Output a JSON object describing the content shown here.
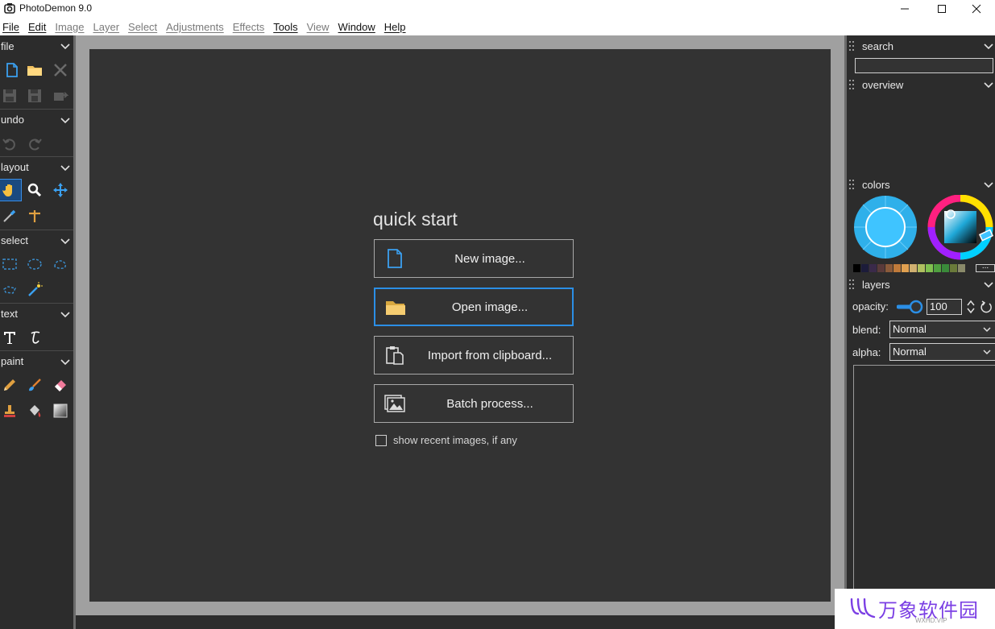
{
  "window": {
    "title": "PhotoDemon 9.0",
    "minimize_icon": "minimize-icon",
    "maximize_icon": "maximize-icon",
    "close_icon": "close-icon"
  },
  "menu": [
    {
      "label": "File",
      "enabled": true
    },
    {
      "label": "Edit",
      "enabled": true
    },
    {
      "label": "Image",
      "enabled": false
    },
    {
      "label": "Layer",
      "enabled": false
    },
    {
      "label": "Select",
      "enabled": false
    },
    {
      "label": "Adjustments",
      "enabled": false
    },
    {
      "label": "Effects",
      "enabled": false
    },
    {
      "label": "Tools",
      "enabled": true
    },
    {
      "label": "View",
      "enabled": false
    },
    {
      "label": "Window",
      "enabled": true
    },
    {
      "label": "Help",
      "enabled": true
    }
  ],
  "toolbox": {
    "sections": [
      "file",
      "undo",
      "layout",
      "select",
      "text",
      "paint"
    ],
    "active_tool": "hand-tool"
  },
  "quick_start": {
    "title": "quick start",
    "buttons": [
      {
        "label": "New image...",
        "icon": "new-document-icon"
      },
      {
        "label": "Open image...",
        "icon": "folder-icon"
      },
      {
        "label": "Import from clipboard...",
        "icon": "clipboard-icon"
      },
      {
        "label": "Batch process...",
        "icon": "batch-images-icon"
      }
    ],
    "show_recent_label": "show recent images, if any",
    "show_recent_checked": false
  },
  "right_panel": {
    "search_label": "search",
    "overview_label": "overview",
    "colors_label": "colors",
    "more_colors": "...",
    "palette": [
      "#000000",
      "#1c1c3a",
      "#3a2a4a",
      "#5a3a3a",
      "#8a5a3a",
      "#c07a3a",
      "#e0a050",
      "#d0b070",
      "#b0c060",
      "#80c050",
      "#50a040",
      "#3a8a3a",
      "#6a7a3a",
      "#8a8a6a"
    ],
    "primary_color": "#3fc4ff",
    "layers_label": "layers",
    "opacity_label": "opacity:",
    "opacity_value": "100",
    "blend_label": "blend:",
    "blend_value": "Normal",
    "alpha_label": "alpha:",
    "alpha_value": "Normal"
  },
  "watermark": {
    "text": "万象软件园",
    "subtext": "WXHD.VIP"
  }
}
